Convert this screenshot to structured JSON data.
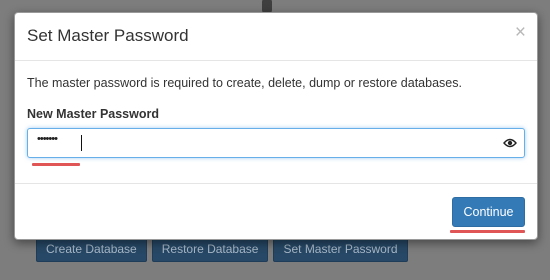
{
  "background": {
    "buttons": [
      "Create Database",
      "Restore Database",
      "Set Master Password"
    ]
  },
  "modal": {
    "title": "Set Master Password",
    "close_label": "×",
    "description": "The master password is required to create, delete, dump or restore databases.",
    "field_label": "New Master Password",
    "password_value": "•••••••",
    "continue_label": "Continue"
  },
  "colors": {
    "primary": "#337ab7",
    "focus_border": "#66afe9",
    "annotation_red": "#e05555"
  },
  "icons": {
    "reveal": "eye-icon",
    "close": "close-icon"
  }
}
